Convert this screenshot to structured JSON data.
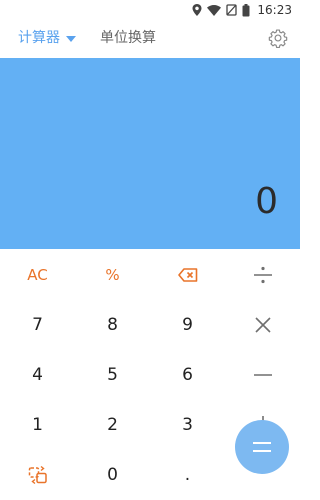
{
  "status_bar": {
    "time": "16:23",
    "icons": [
      "location-icon",
      "wifi-icon",
      "sim-off-icon",
      "battery-icon"
    ]
  },
  "header": {
    "tabs": [
      {
        "label": "计算器",
        "active": true
      },
      {
        "label": "单位换算",
        "active": false
      }
    ],
    "settings_icon": "gear-icon"
  },
  "display": {
    "value": "0"
  },
  "keypad": {
    "rows": [
      [
        "AC",
        "%",
        "backspace-icon",
        "divide-icon"
      ],
      [
        "7",
        "8",
        "9",
        "multiply-icon"
      ],
      [
        "4",
        "5",
        "6",
        "minus-icon"
      ],
      [
        "1",
        "2",
        "3",
        "plus-icon"
      ],
      [
        "swap-icon",
        "0",
        ".",
        "equals-icon"
      ]
    ],
    "labels": {
      "ac": "AC",
      "percent": "%",
      "d7": "7",
      "d8": "8",
      "d9": "9",
      "d4": "4",
      "d5": "5",
      "d6": "6",
      "d1": "1",
      "d2": "2",
      "d3": "3",
      "d0": "0",
      "dot": "."
    }
  },
  "colors": {
    "accent": "#5aa2ee",
    "display_bg": "#63b0f4",
    "function_key": "#e9742a",
    "operator": "#6f6f6f",
    "equals_bg": "#7db9f1"
  }
}
